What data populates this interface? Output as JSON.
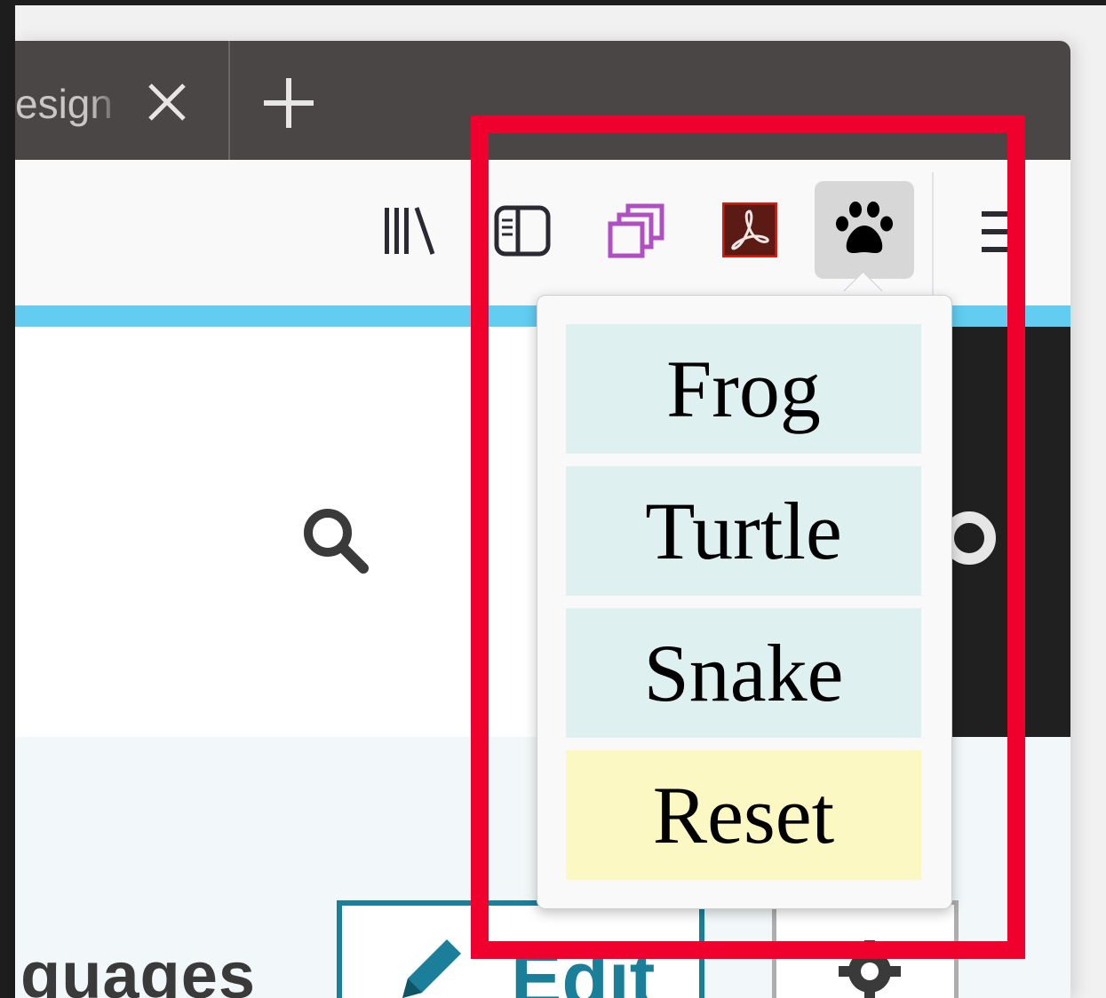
{
  "tab": {
    "title": "esign",
    "close_icon": "close-icon",
    "new_tab_icon": "plus-icon"
  },
  "toolbar": {
    "icons": [
      "library-icon",
      "sidebar-icon",
      "containers-icon",
      "acrobat-icon",
      "paw-icon",
      "menu-icon"
    ]
  },
  "page": {
    "languages_text": "guages",
    "edit_label": "Edit",
    "search_icon": "search-icon",
    "settings_icon": "gear-icon"
  },
  "popup": {
    "items": [
      {
        "label": "Frog"
      },
      {
        "label": "Turtle"
      },
      {
        "label": "Snake"
      },
      {
        "label": "Reset"
      }
    ]
  },
  "colors": {
    "tab_bar": "#4a4645",
    "load_bar": "#62cdf1",
    "popup_item_bg": "#dff0f0",
    "reset_bg": "#fbf8c4",
    "highlight": "#f0002d",
    "accent": "#1b7f99"
  }
}
